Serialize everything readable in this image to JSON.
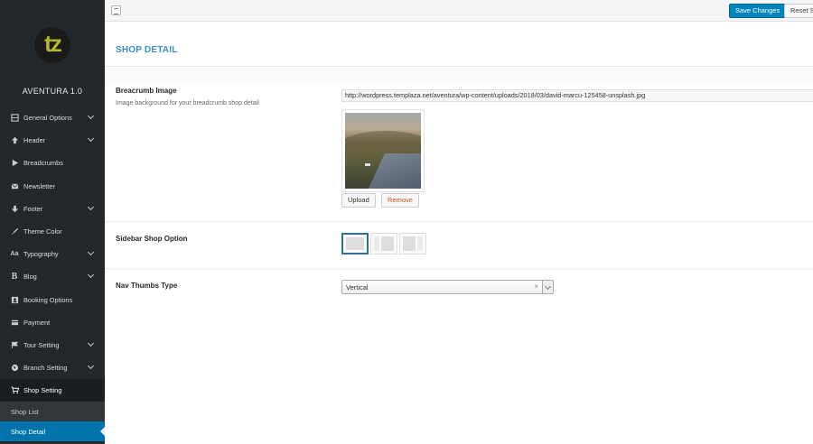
{
  "brand": {
    "logo_text": "tz",
    "name": "AVENTURA 1.0"
  },
  "sidebar": {
    "items": [
      {
        "label": "General Options",
        "icon": "sliders-icon",
        "has_children": true
      },
      {
        "label": "Header",
        "icon": "arrow-up-icon",
        "has_children": true
      },
      {
        "label": "Breadcrumbs",
        "icon": "play-icon",
        "has_children": false
      },
      {
        "label": "Newsletter",
        "icon": "email-icon",
        "has_children": false
      },
      {
        "label": "Footer",
        "icon": "arrow-down-icon",
        "has_children": true
      },
      {
        "label": "Theme Color",
        "icon": "brush-icon",
        "has_children": false
      },
      {
        "label": "Typography",
        "icon": "font-icon",
        "has_children": true
      },
      {
        "label": "Blog",
        "icon": "bold-b-icon",
        "has_children": true
      },
      {
        "label": "Booking Options",
        "icon": "contact-card-icon",
        "has_children": false
      },
      {
        "label": "Payment",
        "icon": "card-icon",
        "has_children": false
      },
      {
        "label": "Tour Setting",
        "icon": "flag-icon",
        "has_children": true
      },
      {
        "label": "Branch Setting",
        "icon": "globe-icon",
        "has_children": true
      },
      {
        "label": "Shop Setting",
        "icon": "cart-icon",
        "has_children": false
      }
    ],
    "sub_items": [
      {
        "label": "Shop List"
      },
      {
        "label": "Shop Detail"
      }
    ]
  },
  "toolbar": {
    "save_label": "Save Changes",
    "reset_label": "Reset Section"
  },
  "page": {
    "title": "SHOP DETAIL"
  },
  "fields": {
    "breadcrumb_image": {
      "title": "Breacrumb Image",
      "description": "Image background for your breadcrumb shop detail",
      "url": "http://wordpress.templaza.net/aventura/wp-content/uploads/2018/03/david-marcu-125458-unsplash.jpg",
      "upload_label": "Upload",
      "remove_label": "Remove"
    },
    "sidebar_shop": {
      "title": "Sidebar Shop Option",
      "selected": "no-sidebar"
    },
    "nav_thumbs": {
      "title": "Nav Thumbs Type",
      "value": "Vertical",
      "clear": "×"
    }
  },
  "colors": {
    "sidebar_bg": "#23282d",
    "accent": "#0085ba",
    "title": "#3a8fc7",
    "remove": "#d54e21",
    "logo": "#b5b829"
  }
}
